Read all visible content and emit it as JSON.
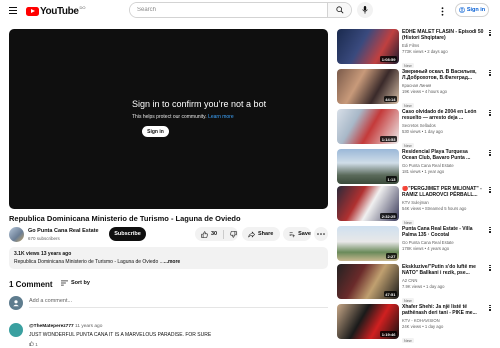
{
  "header": {
    "logo_text": "YouTube",
    "logo_region": "DO",
    "search_placeholder": "Search",
    "signin_label": "Sign in"
  },
  "player": {
    "title": "Sign in to confirm you’re not a bot",
    "subtitle": "This helps protect our community.",
    "learn_more": "Learn more",
    "button_label": "Sign in"
  },
  "video": {
    "title": "Republica Dominicana Ministerio de Turismo - Laguna de Oviedo",
    "channel": "Go Punta Cana Real Estate",
    "subscribers": "670 subscribers",
    "subscribe_label": "Subscribe",
    "likes": "30",
    "share_label": "Share",
    "save_label": "Save",
    "description_meta": "3.1K views  13 years ago",
    "description_text": "Republica Dominicana Ministerio de Turismo - Laguna de Oviedo ...",
    "more_label": "...more"
  },
  "comments": {
    "header": "1 Comment",
    "sort_label": "Sort by",
    "add_placeholder": "Add a comment...",
    "items": [
      {
        "author": "@TheMateperez777",
        "time": "11 years ago",
        "text": "JUST WONDERFUL PUNTA CANA IT IS A MARVELOUS PARADISE. FOR SURE",
        "likes": "1"
      }
    ]
  },
  "recommendations": [
    {
      "title": "EDHE MALET FLASIN - Episodi 50 (Histori Shqiptare)",
      "channel": "Edi Films",
      "meta": "773K views • 2 days ago",
      "badge": "New",
      "duration": "1:08:59"
    },
    {
      "title": "Звериный оскал. В Васильев, Л.Доброхотов, В.Фатеград...",
      "channel": "Красная Линия",
      "meta": "19K views • 4 hours ago",
      "badge": "New",
      "duration": "44:14"
    },
    {
      "title": "Caso olvidado de 2004 en León resuelto — arresto deja ...",
      "channel": "Secretos Sellados",
      "meta": "530 views • 1 day ago",
      "badge": "New",
      "duration": "1:14:53"
    },
    {
      "title": "Residencial Playa Turquesa Ocean Club, Bavaro Punta ...",
      "channel": "Go Punta Cana Real Estate",
      "meta": "181 views • 1 year ago",
      "badge": "",
      "duration": "1:13"
    },
    {
      "title": "🔴\"PËRGJIMET PËR MILIONAT\" - RAMIZ LLADROVCI PËRBALL...",
      "channel": "KTV Sulejman",
      "meta": "54K views • Streamed 5 hours ago",
      "badge": "New",
      "duration": "2:32:25"
    },
    {
      "title": "Punta Cana Real Estate - Villa Palma 135 · Cocotal",
      "channel": "Go Punta Cana Real Estate",
      "meta": "178K views • 4 years ago",
      "badge": "",
      "duration": "2:27"
    },
    {
      "title": "Ekskluzive/\"Putin s'do luftë me NATO\" Ballkani i rezik, pse...",
      "channel": "A2 CNN",
      "meta": "7.9K views • 1 day ago",
      "badge": "New",
      "duration": "47:51"
    },
    {
      "title": "Xhafer Shehi: Ja një listë të pathënash deri tani - PIKE me...",
      "channel": "KTV - KOHAVISION",
      "meta": "24K views • 1 day ago",
      "badge": "New",
      "duration": "1:19:46"
    }
  ]
}
